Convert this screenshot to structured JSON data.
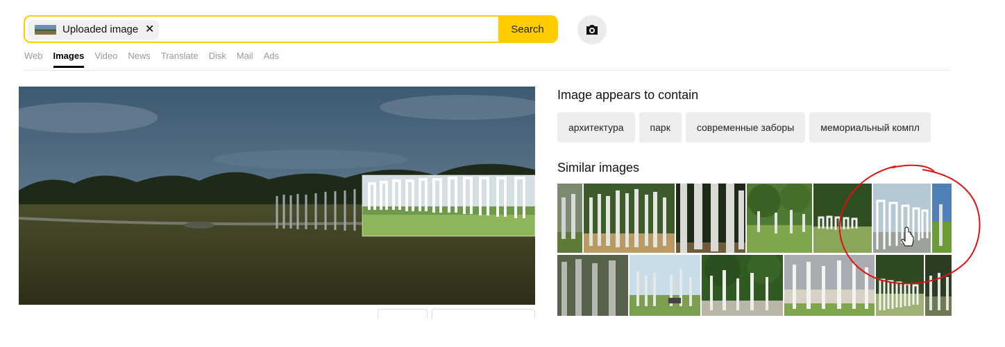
{
  "search": {
    "chip_label": "Uploaded image",
    "chip_close": "✕",
    "button_label": "Search"
  },
  "nav": {
    "items": [
      "Web",
      "Images",
      "Video",
      "News",
      "Translate",
      "Disk",
      "Mail",
      "Ads"
    ],
    "active": "Images"
  },
  "contains": {
    "title": "Image appears to contain",
    "tags": [
      "архитектура",
      "парк",
      "современные заборы",
      "мемориальный компл"
    ]
  },
  "similar": {
    "title": "Similar images"
  },
  "colors": {
    "accent": "#ffcc00",
    "annotation": "#e01010"
  }
}
